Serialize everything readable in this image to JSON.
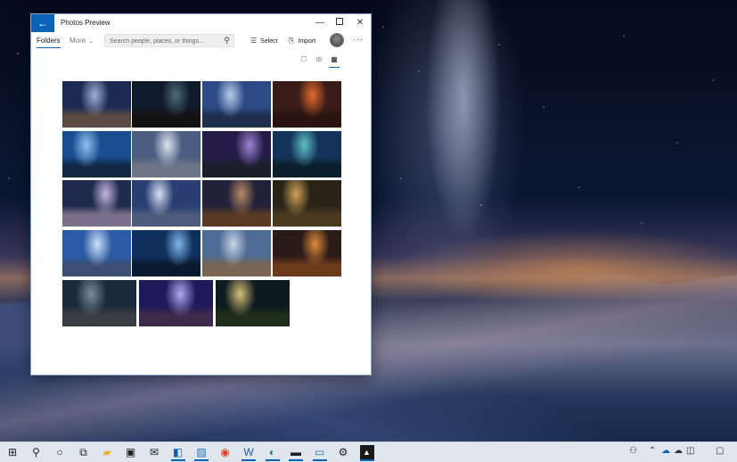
{
  "window": {
    "title": "Photos Preview",
    "back_icon": "arrow-left-icon",
    "controls": [
      "minimize-icon",
      "maximize-icon",
      "close-icon"
    ]
  },
  "toolbar": {
    "tab_folders": "Folders",
    "tab_more": "More",
    "search_placeholder": "Search people, places, or things...",
    "select_label": "Select",
    "import_label": "Import"
  },
  "view_modes": [
    "large-thumbnail-icon",
    "medium-thumbnail-icon",
    "small-thumbnail-icon"
  ],
  "photos": [
    {
      "name": "photo-1",
      "sky": "#1b2a52",
      "glow": "#9fb1d6",
      "ground": "#5a4a42"
    },
    {
      "name": "photo-2",
      "sky": "#0f1a2a",
      "glow": "#4d6a7f",
      "ground": "#121212"
    },
    {
      "name": "photo-3",
      "sky": "#2c4b86",
      "glow": "#b8cbea",
      "ground": "#1d2f4d"
    },
    {
      "name": "photo-4",
      "sky": "#3a1d18",
      "glow": "#e36a2e",
      "ground": "#2a1410"
    },
    {
      "name": "photo-5",
      "sky": "#1a4d90",
      "glow": "#8fc2ee",
      "ground": "#102844"
    },
    {
      "name": "photo-6",
      "sky": "#4b5d80",
      "glow": "#dfe5f1",
      "ground": "#6f7588"
    },
    {
      "name": "photo-7",
      "sky": "#241b48",
      "glow": "#9b84d2",
      "ground": "#1a1e2a"
    },
    {
      "name": "photo-8",
      "sky": "#14335a",
      "glow": "#5ec0c5",
      "ground": "#0b1f2b"
    },
    {
      "name": "photo-9",
      "sky": "#1f2a4d",
      "glow": "#c6b6e0",
      "ground": "#7a6f8c"
    },
    {
      "name": "photo-10",
      "sky": "#2a3e73",
      "glow": "#d8dff0",
      "ground": "#4e5b7c"
    },
    {
      "name": "photo-11",
      "sky": "#23213a",
      "glow": "#b88a63",
      "ground": "#5a3a24"
    },
    {
      "name": "photo-12",
      "sky": "#2a2418",
      "glow": "#d1a456",
      "ground": "#4a3a20"
    },
    {
      "name": "photo-13",
      "sky": "#2b5ba6",
      "glow": "#cfe1f7",
      "ground": "#3a4f73"
    },
    {
      "name": "photo-14",
      "sky": "#10305e",
      "glow": "#7fb6e9",
      "ground": "#0a1a30"
    },
    {
      "name": "photo-15",
      "sky": "#4d6b94",
      "glow": "#c7d4e6",
      "ground": "#7a6552"
    },
    {
      "name": "photo-16",
      "sky": "#2a1a18",
      "glow": "#e08a3a",
      "ground": "#6a3a1a"
    },
    {
      "name": "photo-17",
      "sky": "#1b2a3a",
      "glow": "#7a8c98",
      "ground": "#3a3e42"
    },
    {
      "name": "photo-18",
      "sky": "#20195a",
      "glow": "#b0a8f0",
      "ground": "#3e2a4a"
    },
    {
      "name": "photo-19",
      "sky": "#0d1a20",
      "glow": "#d8c078",
      "ground": "#1e2e1a"
    }
  ],
  "taskbar": {
    "left_icons": [
      "start-icon",
      "search-icon",
      "cortana-icon",
      "task-view-icon",
      "file-explorer-icon",
      "store-icon",
      "mail-icon",
      "outlook-icon",
      "photos-icon",
      "chrome-icon",
      "word-icon",
      "edge-icon",
      "terminal-icon",
      "remote-desktop-icon",
      "settings-icon",
      "photos-preview-icon"
    ],
    "tray_icons": [
      "people-icon",
      "chevron-up-icon",
      "onedrive-icon",
      "cloud-icon",
      "network-icon",
      "notification-icon"
    ]
  }
}
